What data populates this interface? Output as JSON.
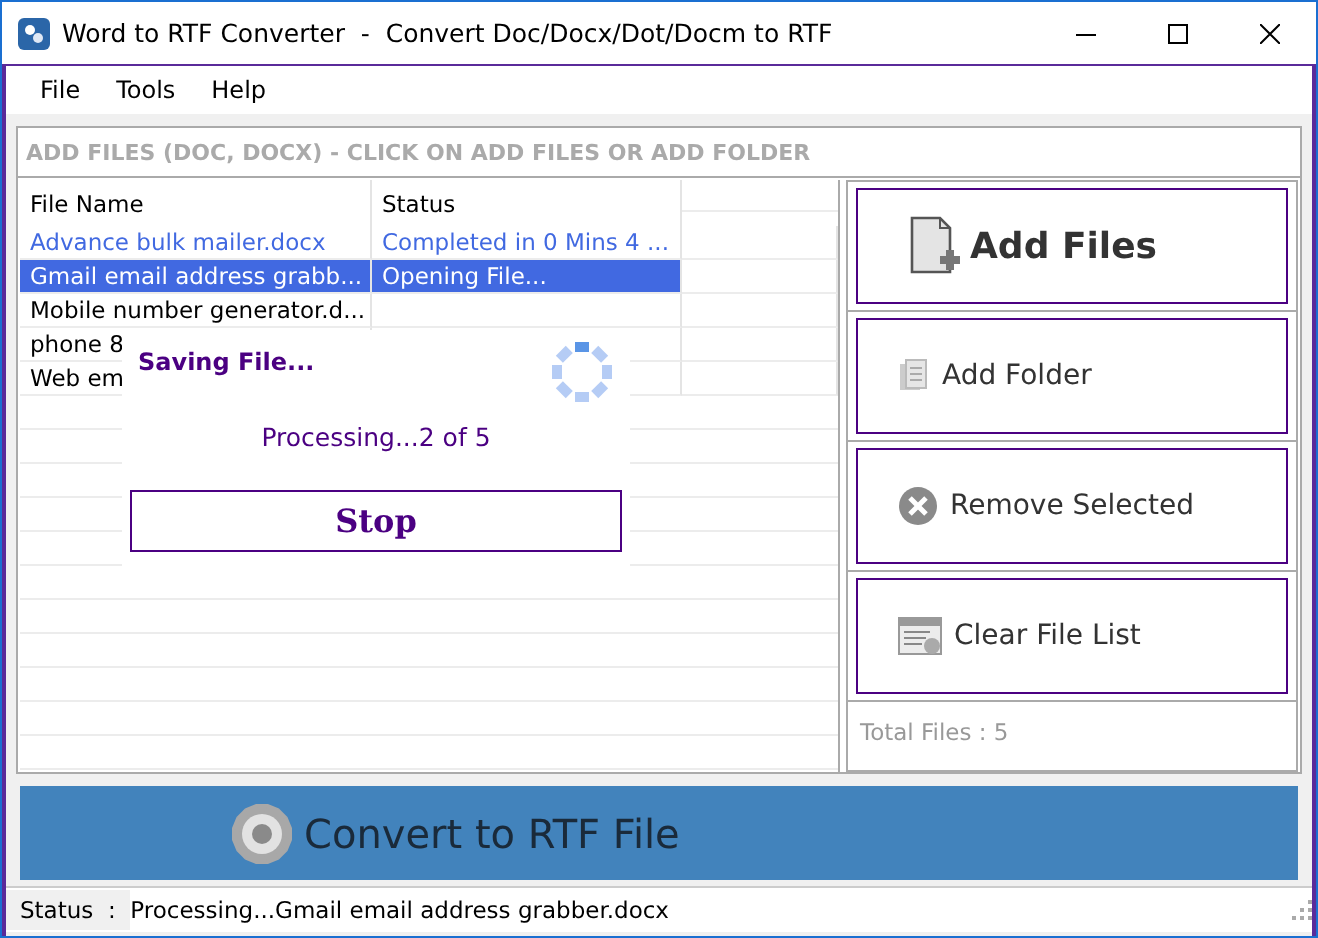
{
  "window": {
    "title": "Word to RTF Converter  -  Convert Doc/Docx/Dot/Docm to RTF"
  },
  "menu": [
    "File",
    "Tools",
    "Help"
  ],
  "panel_header": "ADD FILES (DOC, DOCX) - CLICK ON ADD FILES OR ADD FOLDER",
  "table": {
    "columns": [
      "File Name",
      "Status"
    ],
    "rows": [
      {
        "name": "Advance bulk mailer.docx",
        "status": "Completed in 0 Mins 4 ...",
        "completed": true,
        "selected": false
      },
      {
        "name": "Gmail email address grabb...",
        "status": "Opening File...",
        "completed": false,
        "selected": true
      },
      {
        "name": "Mobile number generator.d...",
        "status": "",
        "completed": false,
        "selected": false
      },
      {
        "name": "phone 8",
        "status": "",
        "completed": false,
        "selected": false
      },
      {
        "name": "Web em",
        "status": "",
        "completed": false,
        "selected": false
      }
    ]
  },
  "dialog": {
    "title": "Saving File...",
    "message": "Processing...2 of 5",
    "button": "Stop"
  },
  "actions": [
    {
      "kind": "add-files",
      "label": "Add Files"
    },
    {
      "kind": "add-folder",
      "label": "Add Folder"
    },
    {
      "kind": "remove",
      "label": "Remove Selected"
    },
    {
      "kind": "clear",
      "label": "Clear File List"
    }
  ],
  "total_files": "Total Files : 5",
  "convert_button": "Convert to RTF File",
  "status_bar": {
    "label": "Status  :",
    "message": "Processing...Gmail email address grabber.docx"
  }
}
